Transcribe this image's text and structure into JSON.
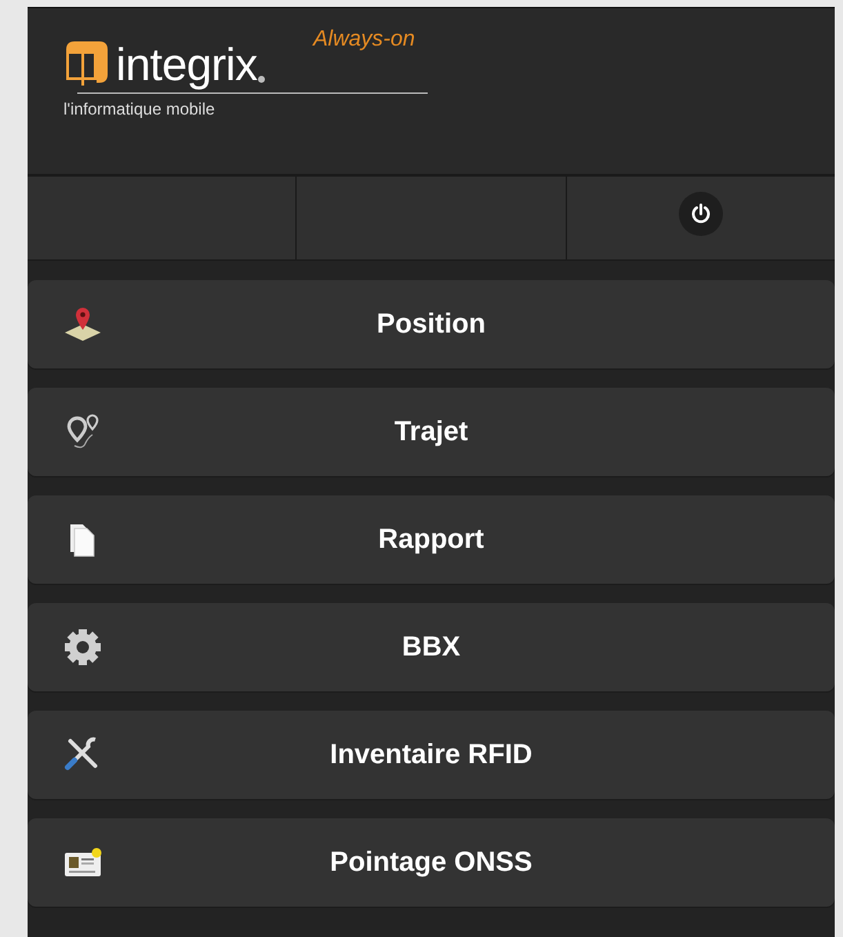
{
  "header": {
    "brand": "integrix",
    "tagline": "Always-on",
    "subtitle": "l'informatique mobile"
  },
  "menu": [
    {
      "label": "Position",
      "kind": "map-pin"
    },
    {
      "label": "Trajet",
      "kind": "route"
    },
    {
      "label": "Rapport",
      "kind": "document"
    },
    {
      "label": "BBX",
      "kind": "gear"
    },
    {
      "label": "Inventaire RFID",
      "kind": "tools"
    },
    {
      "label": "Pointage ONSS",
      "kind": "id-card"
    }
  ]
}
